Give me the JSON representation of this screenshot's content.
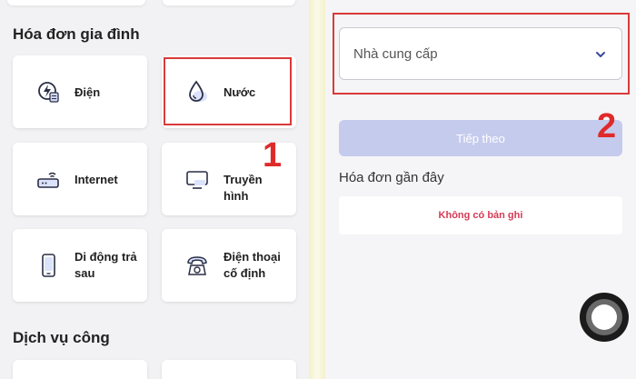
{
  "left": {
    "section_household": "Hóa đơn gia đình",
    "section_public": "Dịch vụ công",
    "cards": {
      "electric": "Điện",
      "water": "Nước",
      "internet": "Internet",
      "tv": "Truyền hình",
      "postpaid": "Di động trả sau",
      "landline": "Điện thoại cố định"
    }
  },
  "right": {
    "provider_placeholder": "Nhà cung cấp",
    "next_button": "Tiếp theo",
    "recent_title": "Hóa đơn gần đây",
    "no_records": "Không có bản ghi"
  },
  "annotations": {
    "step1": "1",
    "step2": "2"
  },
  "colors": {
    "accent": "#6a7bd8",
    "highlight": "#d93a3a",
    "disabled_button": "#c5cbed",
    "empty_text": "#d63a55"
  },
  "icons": [
    "lightning-bill-icon",
    "water-drop-icon",
    "router-icon",
    "tv-icon",
    "mobile-phone-icon",
    "telephone-icon",
    "chevron-down-icon",
    "assistive-touch-icon"
  ]
}
